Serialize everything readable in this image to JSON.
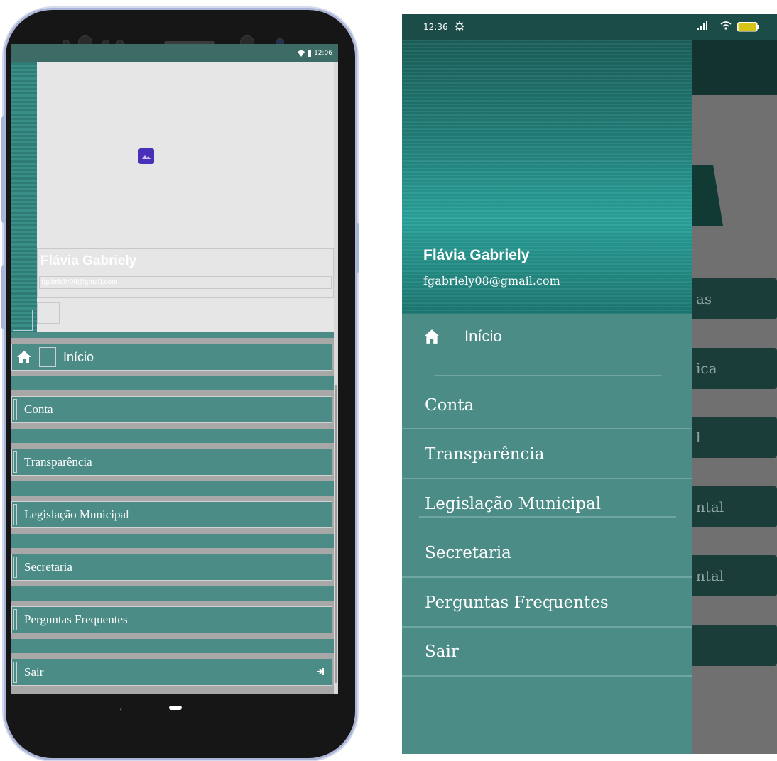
{
  "preview": {
    "status_time": "12:06",
    "user_name": "Flávia Gabriely",
    "user_email": "fgabriely08@gmail.com",
    "menu": [
      {
        "label": "Início"
      },
      {
        "label": "Conta"
      },
      {
        "label": "Transparência"
      },
      {
        "label": "Legislação Municipal"
      },
      {
        "label": "Secretaria"
      },
      {
        "label": "Perguntas Frequentes"
      },
      {
        "label": "Sair"
      }
    ]
  },
  "app": {
    "status_time": "12:36",
    "battery": "82",
    "user_name": "Flávia Gabriely",
    "user_email": "fgabriely08@gmail.com",
    "menu": [
      {
        "label": "Início"
      },
      {
        "label": "Conta"
      },
      {
        "label": "Transparência"
      },
      {
        "label": "Legislação Municipal"
      },
      {
        "label": "Secretaria"
      },
      {
        "label": "Perguntas Frequentes"
      },
      {
        "label": "Sair"
      }
    ],
    "background_buttons": [
      "as",
      "ica",
      "l",
      "ntal",
      "ntal",
      ""
    ]
  },
  "colors": {
    "drawer": "#4c8c86",
    "header": "#23837d",
    "status_bar": "#1c4c48",
    "toolbar": "#12332f"
  }
}
